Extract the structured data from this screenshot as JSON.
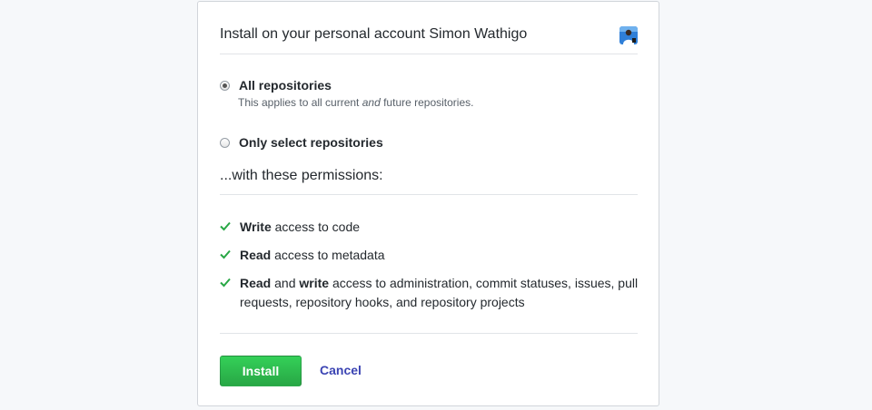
{
  "header": {
    "title": "Install on your personal account Simon Wathigo",
    "avatar_icon": "user-avatar"
  },
  "repository_options": {
    "all": {
      "label": "All repositories",
      "note_before": "This applies to all current ",
      "note_emphasis": "and",
      "note_after": " future repositories.",
      "selected": true
    },
    "select": {
      "label": "Only select repositories",
      "selected": false
    }
  },
  "permissions": {
    "heading": "...with these permissions:",
    "items": [
      {
        "bold1": "Write",
        "text1": " access to code",
        "bold2": "",
        "text2": ""
      },
      {
        "bold1": "Read",
        "text1": " access to metadata",
        "bold2": "",
        "text2": ""
      },
      {
        "bold1": "Read",
        "text1": " and ",
        "bold2": "write",
        "text2": " access to administration, commit statuses, issues, pull requests, repository hooks, and repository projects"
      }
    ],
    "check_icon": "check-icon",
    "check_color": "#28a745"
  },
  "actions": {
    "install_label": "Install",
    "cancel_label": "Cancel"
  },
  "colors": {
    "install_button": "#2cbe4e",
    "cancel_link": "#3b44b3"
  }
}
